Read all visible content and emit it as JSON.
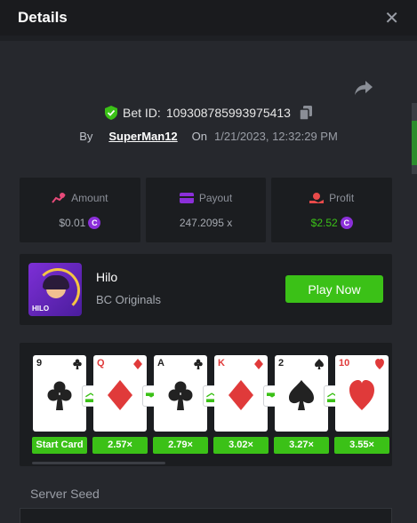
{
  "header": {
    "title": "Details"
  },
  "bet": {
    "id_label": "Bet ID:",
    "id_value": "109308785993975413",
    "by_label": "By",
    "user": "SuperMan12",
    "on_label": "On",
    "date": "1/21/2023, 12:32:29 PM"
  },
  "stats": {
    "amount_label": "Amount",
    "amount_value": "$0.01",
    "payout_label": "Payout",
    "payout_value": "247.2095 x",
    "profit_label": "Profit",
    "profit_value": "$2.52",
    "coin_symbol": "C"
  },
  "game": {
    "name": "Hilo",
    "provider": "BC Originals",
    "play_label": "Play Now",
    "thumb_tag": "HILO"
  },
  "cards": [
    {
      "rank": "9",
      "suit": "club",
      "color": "#222"
    },
    {
      "rank": "Q",
      "suit": "diamond",
      "color": "#e03a3a"
    },
    {
      "rank": "A",
      "suit": "club",
      "color": "#222"
    },
    {
      "rank": "K",
      "suit": "diamond",
      "color": "#e03a3a"
    },
    {
      "rank": "2",
      "suit": "spade",
      "color": "#222"
    },
    {
      "rank": "10",
      "suit": "heart",
      "color": "#e03a3a"
    }
  ],
  "multipliers": [
    "Start Card",
    "2.57×",
    "2.79×",
    "3.02×",
    "3.27×",
    "3.55×"
  ],
  "guesses": [
    "higher",
    "lower",
    "higher",
    "lower",
    "higher"
  ],
  "seed": {
    "label": "Server Seed"
  },
  "colors": {
    "accent": "#3bc117",
    "coin": "#8b2fd9",
    "amount_icon": "#e84a7a",
    "payout_icon": "#8b2fd9",
    "profit_icon": "#e84a4a"
  }
}
